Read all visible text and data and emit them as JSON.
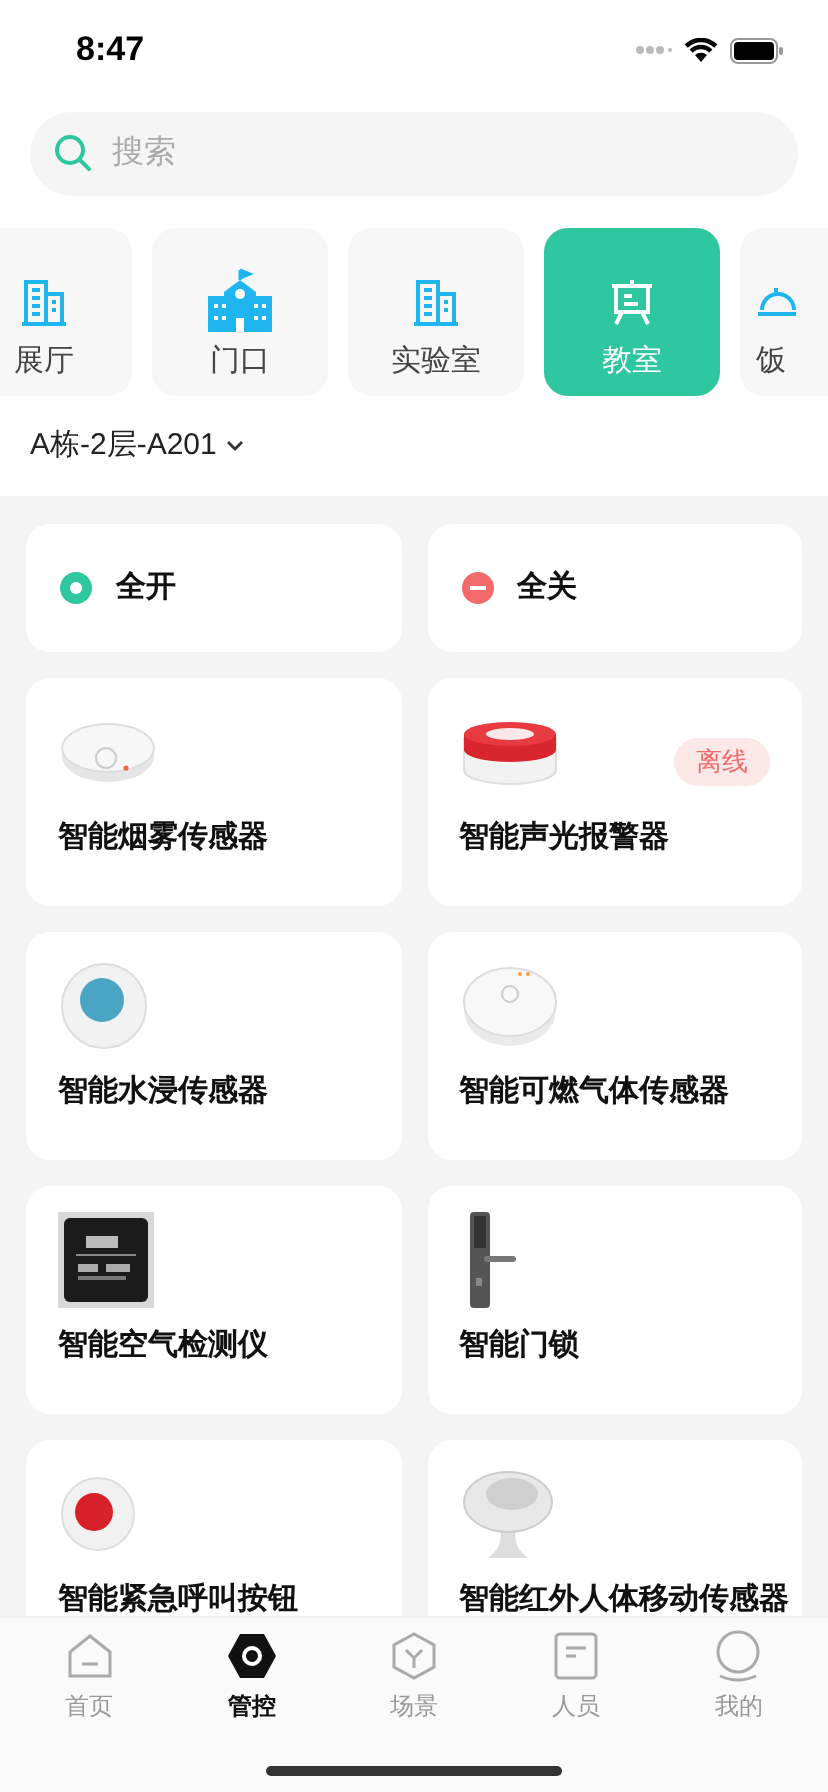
{
  "status_bar": {
    "time": "8:47"
  },
  "search": {
    "placeholder": "搜索"
  },
  "categories": [
    {
      "label": "展厅",
      "kind": "building",
      "selected": false
    },
    {
      "label": "门口",
      "kind": "school",
      "selected": false
    },
    {
      "label": "实验室",
      "kind": "building",
      "selected": false
    },
    {
      "label": "教室",
      "kind": "easel",
      "selected": true
    },
    {
      "label": "饭",
      "kind": "dish",
      "selected": false
    }
  ],
  "location": {
    "label": "A栋-2层-A201"
  },
  "quick_actions": [
    {
      "label": "全开",
      "kind": "on"
    },
    {
      "label": "全关",
      "kind": "off"
    }
  ],
  "device_rows": [
    [
      {
        "name": "智能烟雾传感器",
        "kind": "smoke"
      },
      {
        "name": "智能声光报警器",
        "kind": "alarm",
        "badge": "离线"
      }
    ],
    [
      {
        "name": "智能水浸传感器",
        "kind": "water"
      },
      {
        "name": "智能可燃气体传感器",
        "kind": "gas"
      }
    ],
    [
      {
        "name": "智能空气检测仪",
        "kind": "air"
      },
      {
        "name": "智能门锁",
        "kind": "lock"
      }
    ],
    [
      {
        "name": "智能紧急呼叫按钮",
        "kind": "button"
      },
      {
        "name": "智能红外人体移动传感器",
        "kind": "motion"
      }
    ]
  ],
  "tab_bar": [
    {
      "label": "首页",
      "kind": "home",
      "selected": false
    },
    {
      "label": "管控",
      "kind": "control",
      "selected": true
    },
    {
      "label": "场景",
      "kind": "scene",
      "selected": false
    },
    {
      "label": "人员",
      "kind": "people",
      "selected": false
    },
    {
      "label": "我的",
      "kind": "me",
      "selected": false
    }
  ]
}
